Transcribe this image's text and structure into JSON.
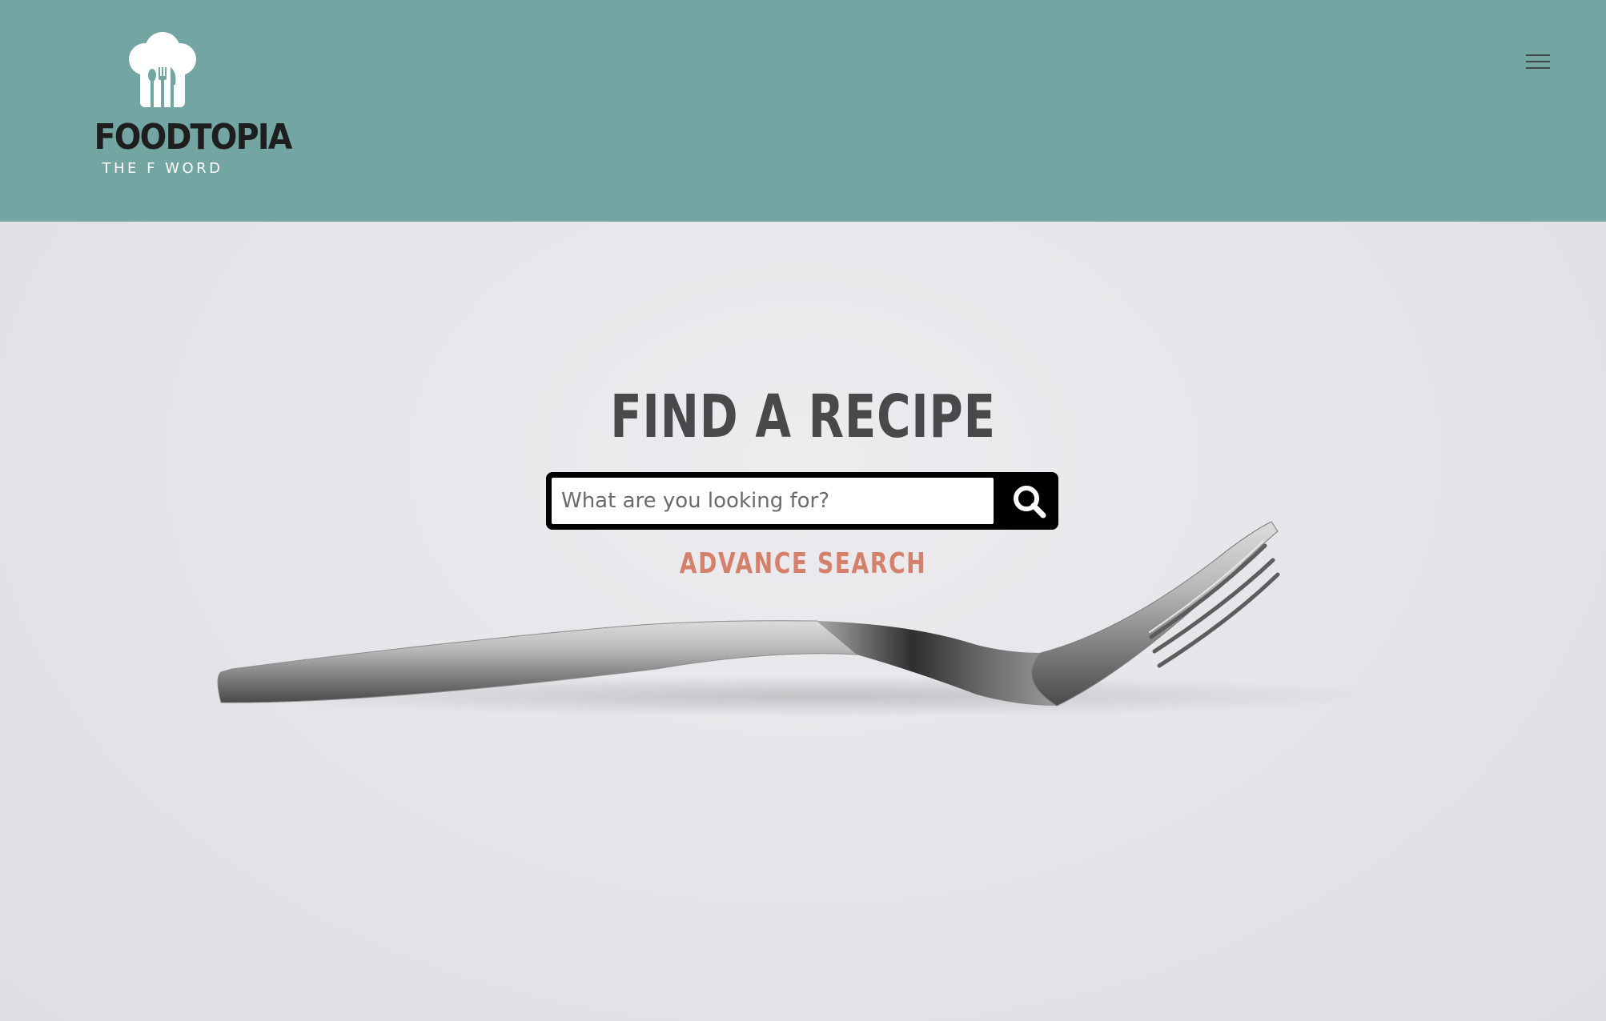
{
  "header": {
    "logo": {
      "name": "FOODTOPIA",
      "tagline": "THE F WORD",
      "icon": "chef-hat-icon"
    },
    "menu_icon": "hamburger-menu-icon",
    "background_color": "#73a5a2"
  },
  "hero": {
    "background_image": "fork-photo",
    "heading": "FIND A RECIPE",
    "search": {
      "placeholder": "What are you looking for?",
      "value": "",
      "button_icon": "search-icon"
    },
    "advance_search_label": "ADVANCE SEARCH",
    "accent_color": "#d4806a"
  }
}
